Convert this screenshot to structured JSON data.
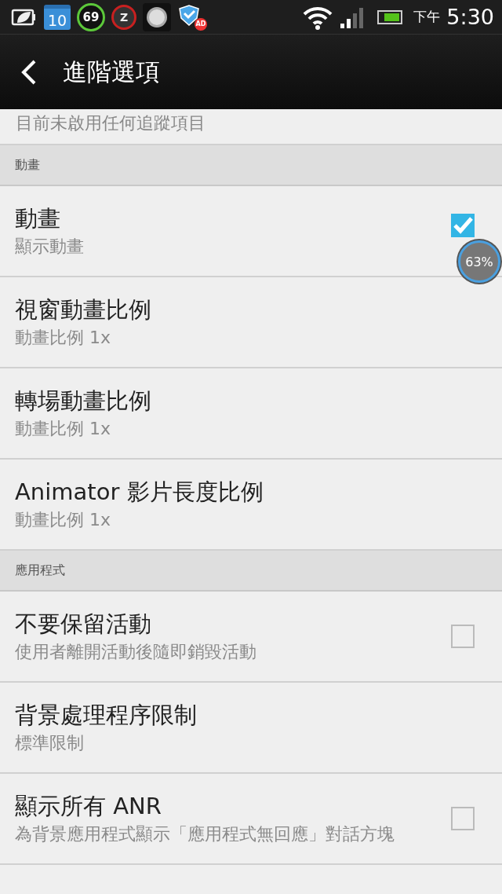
{
  "status_bar": {
    "calendar": "10",
    "gauge": "69",
    "alarm": "Z",
    "badge": "AD",
    "ampm": "下午",
    "time": "5:30"
  },
  "action_bar": {
    "title": "進階選項"
  },
  "list": [
    {
      "kind": "partial",
      "summary": "目前未啟用任何追蹤項目"
    },
    {
      "kind": "section",
      "title": "動畫"
    },
    {
      "kind": "checkbox",
      "title": "動畫",
      "summary": "顯示動畫",
      "checked": true
    },
    {
      "kind": "item",
      "title": "視窗動畫比例",
      "summary": "動畫比例 1x"
    },
    {
      "kind": "item",
      "title": "轉場動畫比例",
      "summary": "動畫比例 1x"
    },
    {
      "kind": "item",
      "title": "Animator 影片長度比例",
      "summary": "動畫比例 1x"
    },
    {
      "kind": "section",
      "title": "應用程式"
    },
    {
      "kind": "checkbox",
      "title": "不要保留活動",
      "summary": "使用者離開活動後隨即銷毀活動",
      "checked": false
    },
    {
      "kind": "item",
      "title": "背景處理程序限制",
      "summary": "標準限制"
    },
    {
      "kind": "checkbox",
      "title": "顯示所有 ANR",
      "summary": "為背景應用程式顯示「應用程式無回應」對話方塊",
      "checked": false
    }
  ],
  "memory_widget": {
    "text": "63%"
  }
}
